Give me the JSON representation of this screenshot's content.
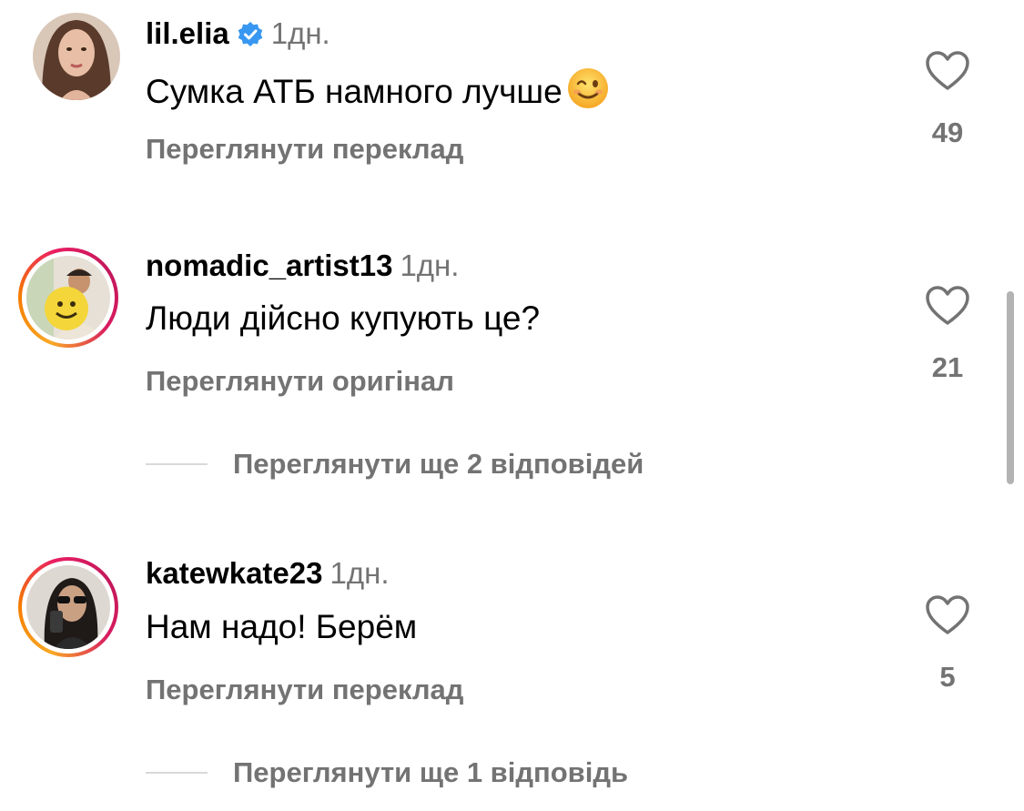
{
  "comments": [
    {
      "username": "lil.elia",
      "verified": true,
      "time": "1дн.",
      "text": "Сумка АТБ намного лучше",
      "emoji": "winking-face",
      "action": "Переглянути переклад",
      "likes": "49"
    },
    {
      "username": "nomadic_artist13",
      "verified": false,
      "time": "1дн.",
      "text": "Люди дійсно купують це?",
      "action": "Переглянути оригінал",
      "likes": "21",
      "replies": "Переглянути ще 2 відповідей"
    },
    {
      "username": "katewkate23",
      "verified": false,
      "time": "1дн.",
      "text": "Нам надо! Берём",
      "action": "Переглянути переклад",
      "likes": "5",
      "replies": "Переглянути ще 1 відповідь"
    }
  ],
  "colors": {
    "verified": "#3897f0",
    "secondary_text": "#737373",
    "story_ring_start": "#f9a825",
    "story_ring_end": "#d81b60"
  }
}
